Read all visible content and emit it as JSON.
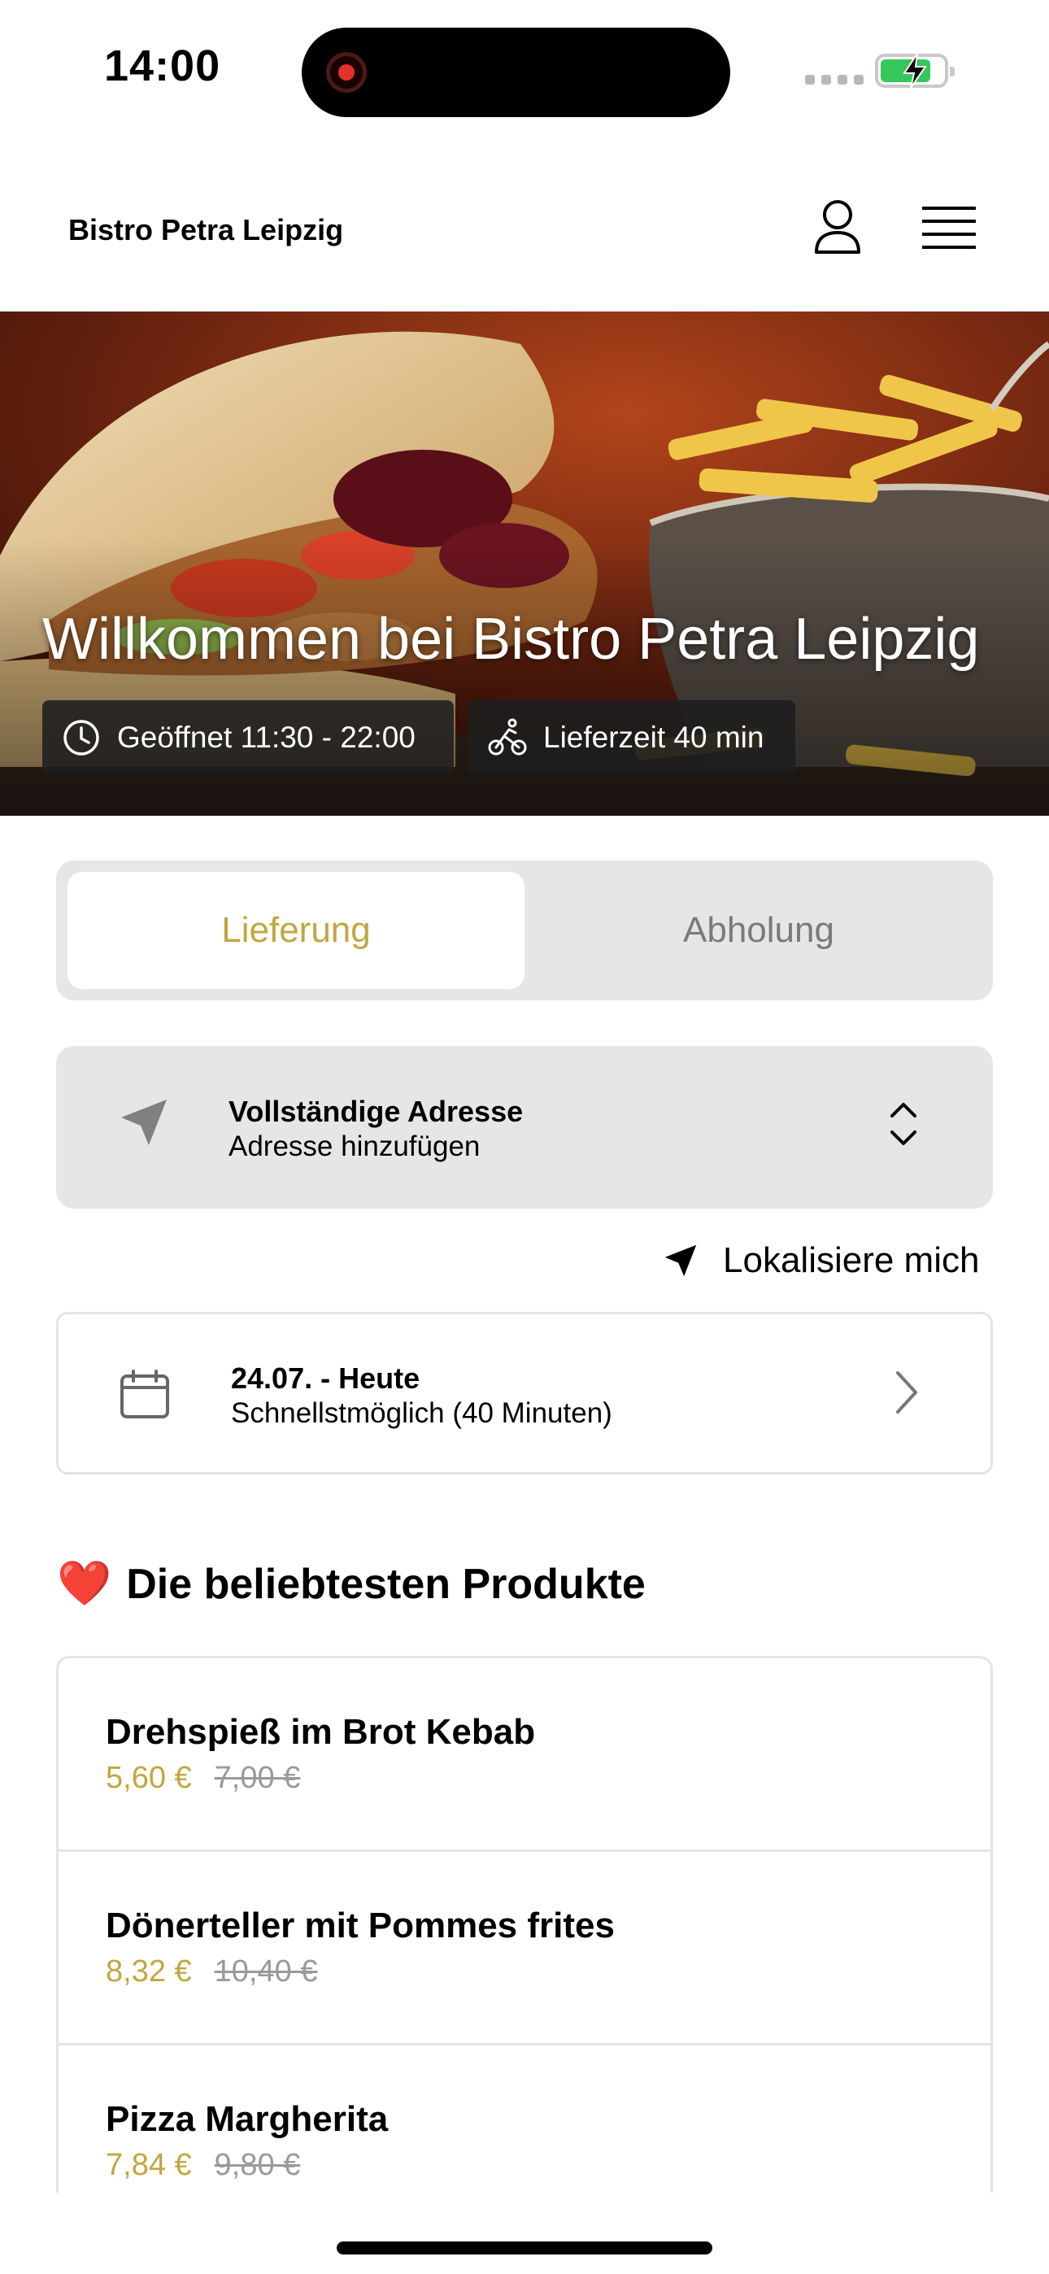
{
  "status_bar": {
    "time": "14:00"
  },
  "header": {
    "brand": "Bistro Petra Leipzig"
  },
  "hero": {
    "title": "Willkommen bei Bistro Petra Leipzig",
    "open_hours": "Geöffnet 11:30 - 22:00",
    "delivery_time": "Lieferzeit 40 min"
  },
  "order_mode": {
    "delivery_label": "Lieferung",
    "pickup_label": "Abholung",
    "selected": "Lieferung"
  },
  "address": {
    "title": "Vollständige Adresse",
    "subtitle": "Adresse hinzufügen"
  },
  "locate_label": "Lokalisiere mich",
  "schedule": {
    "title": "24.07. - Heute",
    "subtitle": "Schnellstmöglich (40 Minuten)"
  },
  "popular": {
    "emoji": "❤️",
    "heading": "Die beliebtesten Produkte",
    "products": [
      {
        "name": "Drehspieß im Brot Kebab",
        "price": "5,60 €",
        "old_price": "7,00 €"
      },
      {
        "name": "Dönerteller mit Pommes frites",
        "price": "8,32 €",
        "old_price": "10,40 €"
      },
      {
        "name": "Pizza Margherita",
        "price": "7,84 €",
        "old_price": "9,80 €"
      }
    ]
  },
  "colors": {
    "accent": "#c2a63f",
    "card_bg": "#e6e6e6",
    "muted": "#7a7a7a"
  }
}
